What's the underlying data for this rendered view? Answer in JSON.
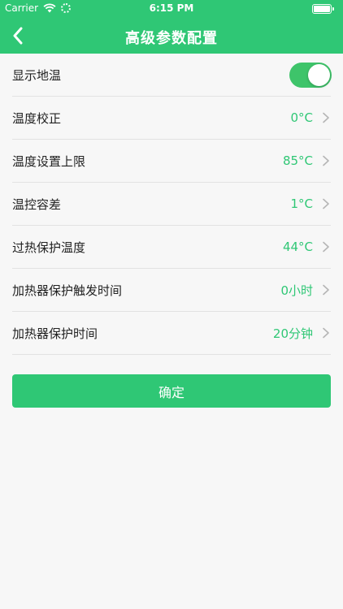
{
  "status_bar": {
    "carrier": "Carrier",
    "time": "6:15 PM",
    "icons": [
      "wifi-icon",
      "loading-spinner-icon",
      "battery-icon"
    ]
  },
  "header": {
    "title": "高级参数配置",
    "back_icon": "chevron-left-icon"
  },
  "settings": [
    {
      "label": "显示地温",
      "type": "toggle",
      "on": true
    },
    {
      "label": "温度校正",
      "value": "0°C"
    },
    {
      "label": "温度设置上限",
      "value": "85°C"
    },
    {
      "label": "温控容差",
      "value": "1°C"
    },
    {
      "label": "过热保护温度",
      "value": "44°C"
    },
    {
      "label": "加热器保护触发时间",
      "value": "0小时"
    },
    {
      "label": "加热器保护时间",
      "value": "20分钟"
    }
  ],
  "confirm_button": {
    "label": "确定"
  },
  "colors": {
    "brand_green": "#2fc775",
    "toggle_green": "#3ec46a",
    "background": "#f7f7f7",
    "divider": "#e2e2e2"
  }
}
